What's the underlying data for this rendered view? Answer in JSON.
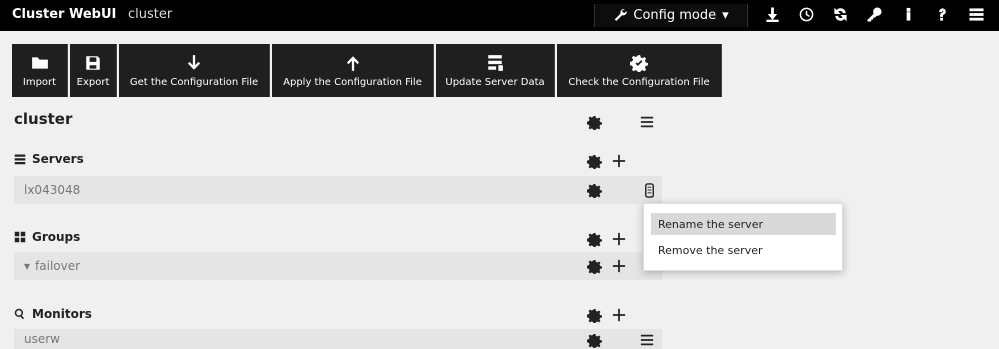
{
  "topbar": {
    "brand": "Cluster WebUI",
    "cluster": "cluster",
    "mode": "Config mode"
  },
  "toolbar": [
    {
      "label": "Import",
      "icon": "folder-icon"
    },
    {
      "label": "Export",
      "icon": "save-icon"
    },
    {
      "label": "Get the Configuration File",
      "icon": "arrow-down-icon"
    },
    {
      "label": "Apply the Configuration File",
      "icon": "arrow-up-icon"
    },
    {
      "label": "Update Server Data",
      "icon": "server-data-icon"
    },
    {
      "label": "Check the Configuration File",
      "icon": "gear-check-icon"
    }
  ],
  "main": {
    "title": "cluster",
    "servers": {
      "label": "Servers",
      "items": [
        "lx043048"
      ]
    },
    "groups": {
      "label": "Groups",
      "items": [
        "failover"
      ]
    },
    "monitors": {
      "label": "Monitors",
      "items": [
        "userw"
      ]
    }
  },
  "context_menu": {
    "items": [
      "Rename the server",
      "Remove the server"
    ]
  }
}
